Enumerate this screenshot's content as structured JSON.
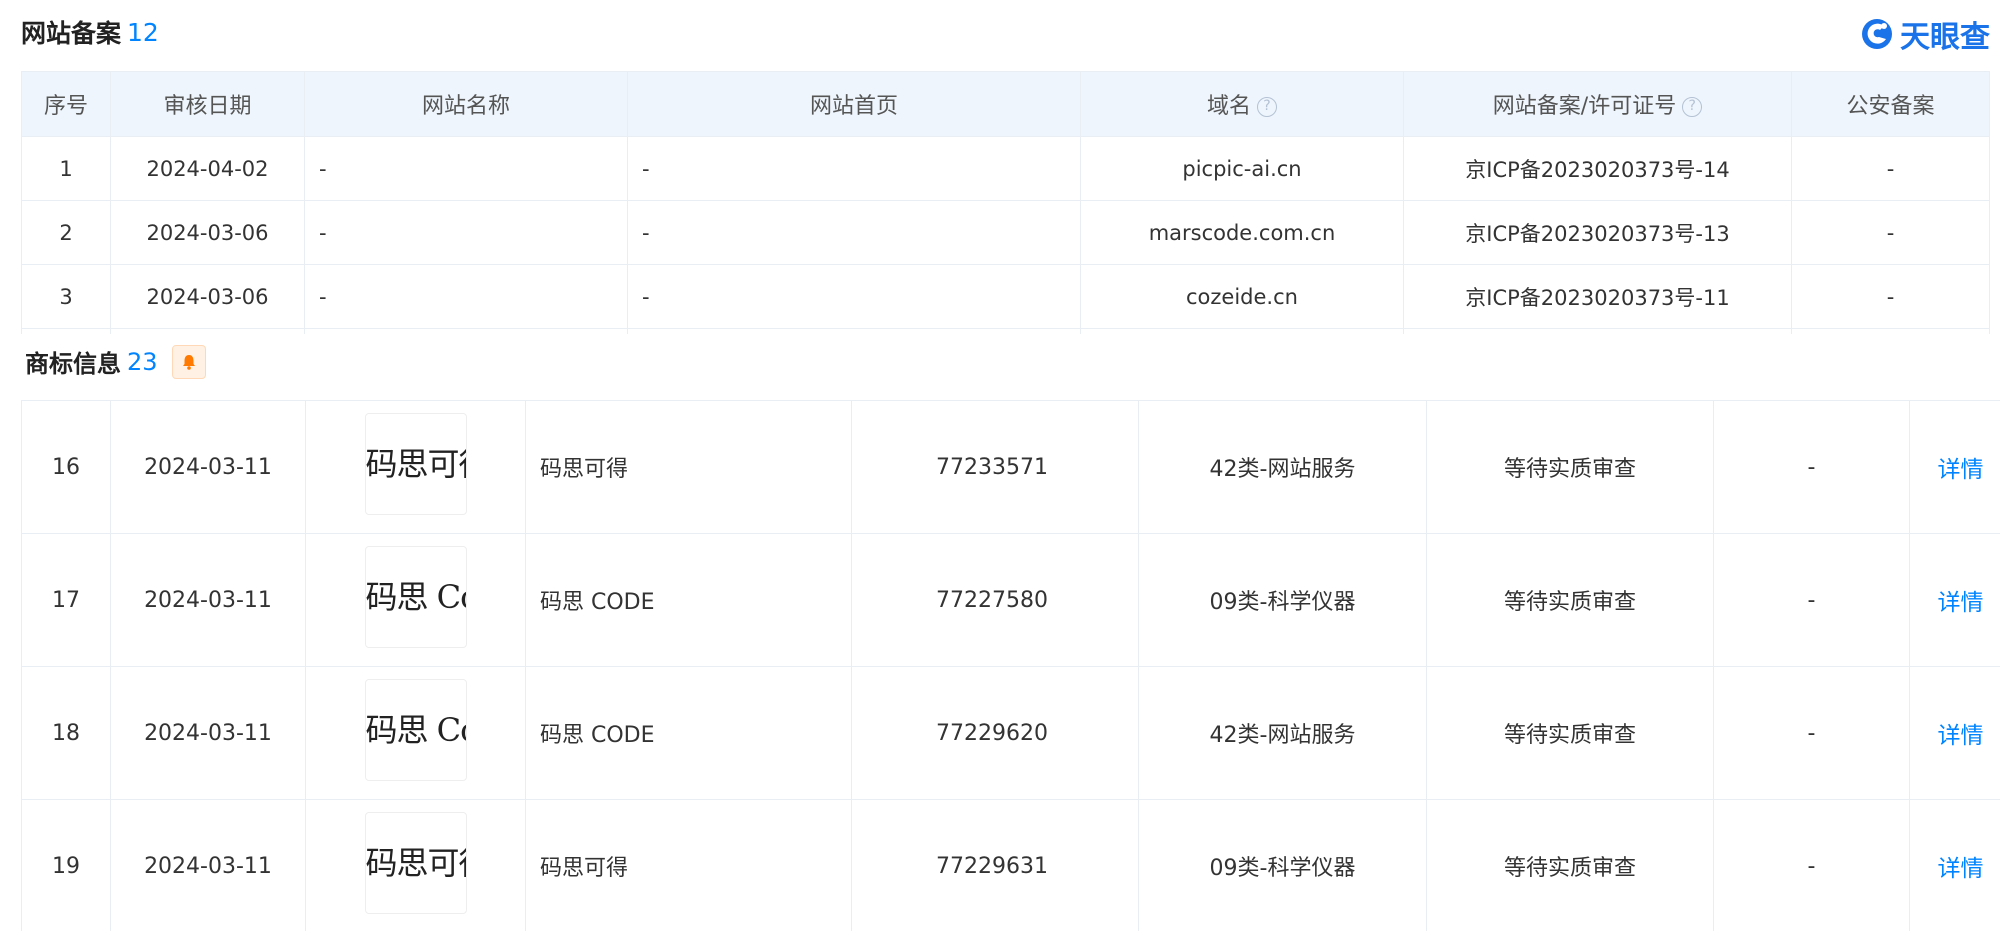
{
  "website_section": {
    "title": "网站备案",
    "count": "12",
    "headers": [
      "序号",
      "审核日期",
      "网站名称",
      "网站首页",
      "域名",
      "网站备案/许可证号",
      "公安备案"
    ],
    "rows": [
      {
        "no": "1",
        "date": "2024-04-02",
        "name": "-",
        "home": "-",
        "domain": "picpic-ai.cn",
        "license": "京ICP备2023020373号-14",
        "police": "-"
      },
      {
        "no": "2",
        "date": "2024-03-06",
        "name": "-",
        "home": "-",
        "domain": "marscode.com.cn",
        "license": "京ICP备2023020373号-13",
        "police": "-"
      },
      {
        "no": "3",
        "date": "2024-03-06",
        "name": "-",
        "home": "-",
        "domain": "cozeide.cn",
        "license": "京ICP备2023020373号-11",
        "police": "-"
      }
    ]
  },
  "logo": {
    "text": "天眼查",
    "color": "#1a73e8"
  },
  "trademark_section": {
    "title": "商标信息",
    "count": "23",
    "rows": [
      {
        "no": "16",
        "date": "2024-03-11",
        "image_text": "码思可得",
        "name": "码思可得",
        "reg_no": "77233571",
        "category": "42类-网站服务",
        "status": "等待实质审查",
        "extra": "-",
        "action": "详情"
      },
      {
        "no": "17",
        "date": "2024-03-11",
        "image_text": "码思 Code",
        "name": "码思 CODE",
        "reg_no": "77227580",
        "category": "09类-科学仪器",
        "status": "等待实质审查",
        "extra": "-",
        "action": "详情"
      },
      {
        "no": "18",
        "date": "2024-03-11",
        "image_text": "码思 Code",
        "name": "码思 CODE",
        "reg_no": "77229620",
        "category": "42类-网站服务",
        "status": "等待实质审查",
        "extra": "-",
        "action": "详情"
      },
      {
        "no": "19",
        "date": "2024-03-11",
        "image_text": "码思可得",
        "name": "码思可得",
        "reg_no": "77229631",
        "category": "09类-科学仪器",
        "status": "等待实质审查",
        "extra": "-",
        "action": "详情"
      }
    ]
  },
  "colors": {
    "accent": "#0084ff",
    "header_bg": "#eef5fc",
    "bell": "#ff7a00"
  }
}
